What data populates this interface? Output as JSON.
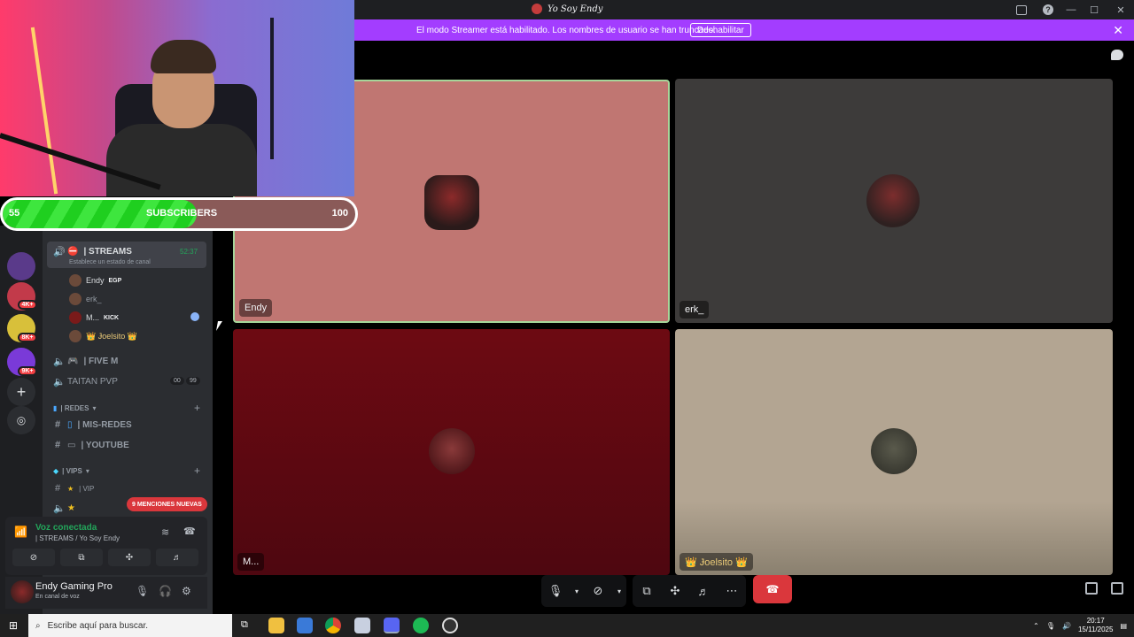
{
  "window": {
    "title": "Yo Soy Endy",
    "icons": [
      "inbox-icon",
      "help-icon",
      "minimize-icon",
      "maximize-icon",
      "close-icon"
    ]
  },
  "banner": {
    "message": "El modo Streamer está habilitado. Los nombres de usuario se han truncado.",
    "button": "Deshabilitar",
    "close": "✕"
  },
  "overlay": {
    "current": "55",
    "label": "SUBSCRIBERS",
    "goal": "100",
    "progress_fraction": 0.55
  },
  "tiles": [
    {
      "name": "Endy"
    },
    {
      "name": "erk_"
    },
    {
      "name": "M..."
    },
    {
      "name": "👑 Ɉoelsito 👑"
    }
  ],
  "sidebar": {
    "badges": [
      "4K+",
      "8K+",
      "9K+"
    ],
    "active_channel": {
      "name": "| STREAMS",
      "timer": "52:37",
      "status_hint": "Establece un estado de canal"
    },
    "members": [
      {
        "name": "Endy",
        "tag": "EGP"
      },
      {
        "name": "erk_",
        "tag": ""
      },
      {
        "name": "M...",
        "tag": "KICK"
      },
      {
        "name": "👑 Ɉoelsito 👑",
        "tag": ""
      }
    ],
    "channels": [
      {
        "name": "| FIVE M"
      },
      {
        "name": "TAITAN PVP"
      },
      {
        "name": "| MIS-REDES"
      },
      {
        "name": "| YOUTUBE"
      },
      {
        "name": "| VIP"
      }
    ],
    "taitan_counts": [
      "00",
      "99"
    ],
    "categories": [
      "| REDES",
      "| VIPS"
    ],
    "mentions_pill": "9 MENCIONES NUEVAS"
  },
  "voice_panel": {
    "status": "Voz conectada",
    "channel": "| STREAMS / Yo Soy Endy"
  },
  "user_panel": {
    "name": "Endy Gaming Pro",
    "status": "En canal de voz"
  },
  "taskbar": {
    "search_placeholder": "Escribe aquí para buscar.",
    "time": "20:17",
    "date": "15/11/2025"
  },
  "colors": {
    "streamer_banner": "#a33dff",
    "voice_green": "#23a55a",
    "hangup_red": "#da373c",
    "mention_red": "#da373c",
    "speaking_border": "#a6d59a"
  }
}
